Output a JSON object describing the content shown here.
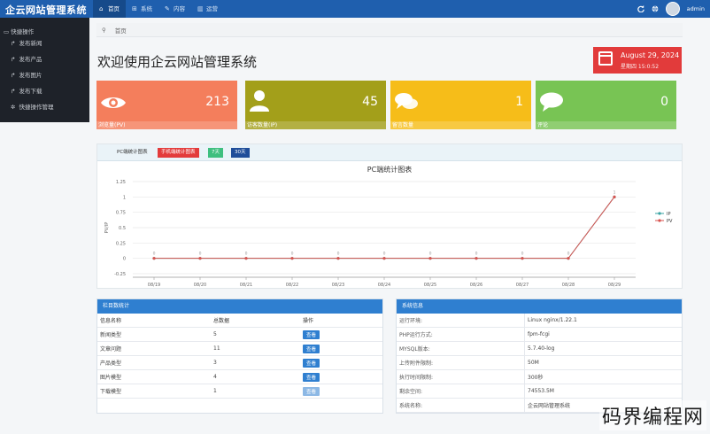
{
  "app": {
    "title": "企云网站管理系统"
  },
  "nav": [
    {
      "label": "首页",
      "icon": "home-icon",
      "glyph": "⌂"
    },
    {
      "label": "系统",
      "icon": "sitemap-icon",
      "glyph": "⊞"
    },
    {
      "label": "内容",
      "icon": "edit-icon",
      "glyph": "✎"
    },
    {
      "label": "运营",
      "icon": "bar-chart-icon",
      "glyph": "▥"
    }
  ],
  "user": {
    "name": "admin"
  },
  "sidebar": {
    "header": "快捷操作",
    "items": [
      {
        "label": "发布新闻",
        "icon": "share-icon"
      },
      {
        "label": "发布产品",
        "icon": "share-icon"
      },
      {
        "label": "发布图片",
        "icon": "share-icon"
      },
      {
        "label": "发布下载",
        "icon": "share-icon"
      },
      {
        "label": "快捷操作管理",
        "icon": "gear-icon"
      }
    ]
  },
  "breadcrumb": {
    "home": "首页"
  },
  "page": {
    "title": "欢迎使用企云网站管理系统"
  },
  "date": {
    "date": "August 29, 2024",
    "weekday_time": "星期四 15:0:52"
  },
  "stats": [
    {
      "label": "浏览量(PV)",
      "value": "213",
      "icon": "eye-icon",
      "color": "#f47e5c"
    },
    {
      "label": "访客数量(IP)",
      "value": "45",
      "icon": "user-icon",
      "color": "#a39f1a"
    },
    {
      "label": "留言数量",
      "value": "1",
      "icon": "comments-icon",
      "color": "#f6bd19"
    },
    {
      "label": "评论",
      "value": "0",
      "icon": "comment-icon",
      "color": "#78c454"
    }
  ],
  "chart_panel": {
    "label": "PC端统计图表",
    "tabs": [
      "手机端统计图表",
      "7天",
      "30天"
    ]
  },
  "chart_data": {
    "type": "line",
    "title": "PC端统计图表",
    "ylabel": "PV/IP",
    "categories": [
      "08/19",
      "08/20",
      "08/21",
      "08/22",
      "08/23",
      "08/24",
      "08/25",
      "08/26",
      "08/27",
      "08/28",
      "08/29"
    ],
    "series": [
      {
        "name": "IP",
        "values": [
          0,
          0,
          0,
          0,
          0,
          0,
          0,
          0,
          0,
          0,
          1
        ],
        "color": "#3aa3a3"
      },
      {
        "name": "PV",
        "values": [
          0,
          0,
          0,
          0,
          0,
          0,
          0,
          0,
          0,
          0,
          1
        ],
        "color": "#d9534f"
      }
    ],
    "yticks": [
      "1.25",
      "1",
      "0.75",
      "0.5",
      "0.25",
      "0",
      "-0.25"
    ],
    "ylim": [
      -0.25,
      1.25
    ],
    "legend": "right"
  },
  "stats_table": {
    "title": "栏目数统计",
    "headers": [
      "信息名称",
      "总数据",
      "操作"
    ],
    "rows": [
      {
        "name": "新闻类型",
        "count": "5",
        "action": "查看"
      },
      {
        "name": "文章问题",
        "count": "11",
        "action": "查看"
      },
      {
        "name": "产品类型",
        "count": "3",
        "action": "查看"
      },
      {
        "name": "图片模型",
        "count": "4",
        "action": "查看"
      },
      {
        "name": "下载模型",
        "count": "1",
        "action": "查看"
      }
    ]
  },
  "sysinfo": {
    "title": "系统信息",
    "rows": [
      {
        "key": "运行环境:",
        "value": "Linux nginx/1.22.1"
      },
      {
        "key": "PHP运行方式:",
        "value": "fpm-fcgi"
      },
      {
        "key": "MYSQL版本:",
        "value": "5.7.40-log"
      },
      {
        "key": "上传附件限制:",
        "value": "50M"
      },
      {
        "key": "执行时间限制:",
        "value": "300秒"
      },
      {
        "key": "剩余空间:",
        "value": "74553.5M"
      },
      {
        "key": "系统名称:",
        "value": "企云网站管理系统"
      }
    ]
  },
  "watermark": {
    "text": "码界编程网"
  }
}
